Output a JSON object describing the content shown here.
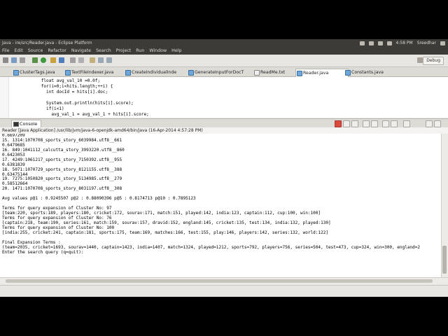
{
  "window": {
    "title": "Java - ire/src/Reader.java - Eclipse Platform",
    "clock": "4:58 PM",
    "user": "Sreedhar"
  },
  "menu": [
    "File",
    "Edit",
    "Source",
    "Refactor",
    "Navigate",
    "Search",
    "Project",
    "Run",
    "Window",
    "Help"
  ],
  "toolbar": {
    "perspective_label": "Debug"
  },
  "tabs": [
    {
      "label": "ClusterTags.java"
    },
    {
      "label": "TextFileIndexer.java"
    },
    {
      "label": "CreateIndividualInde"
    },
    {
      "label": "GenerateInputForDocT"
    },
    {
      "label": "ReadMe.txt"
    },
    {
      "label": "Reader.java"
    },
    {
      "label": "Constants.java"
    }
  ],
  "editor": {
    "lines": [
      "                float avg_val_10 =0.0f;",
      "                for(i=0;i<hits.length;++i) {",
      "                  int docId = hits[i].doc;",
      "",
      "                  System.out.println(hits[i].score);",
      "                  if(i<1)",
      "                    avg_val_1 = avg_val_1 + hits[i].score;"
    ]
  },
  "console": {
    "tab_label": "Console",
    "description": "Reader [Java Application] /usr/lib/jvm/java-6-openjdk-amd64/bin/java (16-Apr-2014 4:57:28 PM)",
    "lines": [
      "0.6697209",
      "15. 1314:1070708_sports_story_6039984.utf8__661",
      "0.6479685",
      "16. 849:1041112_calcutta_story_3993220.utf8__860",
      "0.6423053",
      "17. 4249:1061217_sports_story_7150392.utf8__955",
      "0.6381839",
      "18. 5071:1070729_sports_story_8121155.utf8__388",
      "0.63475144",
      "19. 7275:1050820_sports_story_5134985.utf8__279",
      "0.58512664",
      "20. 1471:1070708_sports_story_8031197.utf8__308",
      "",
      "Avg values p@1 : 0.9245507 p@2 : 0.88090396 p@5 : 0.8174713 p@10 : 0.7895123",
      "",
      "Terms for query expansion of Cluster No: 97",
      "[team:220, sports:189, players:180, cricket:172, sourav:171, match:151, played:142, india:123, captain:112, cup:100, win:100]",
      "Terms for query expansion of Cluster No: 76",
      "[captain:218, team:190, series:161, match:159, sourav:157, dravid:152, england:145, cricket:135, test:134, india:132, played:130]",
      "Terms for query expansion of Cluster No: 100",
      "[india:255, cricket:241, captain:181, sports:175, team:169, matches:166, test:155, play:146, players:142, series:132, world:122]",
      "",
      "Final Expansion Terms :",
      "(team=2035, cricket=1693, sourav=1440, captain=1423, india=1407, match=1324, played=1212, sports=792, players=756, series=504, test=473, cup=324, win=300, england=2",
      "Enter the search query (q=quit):"
    ]
  }
}
